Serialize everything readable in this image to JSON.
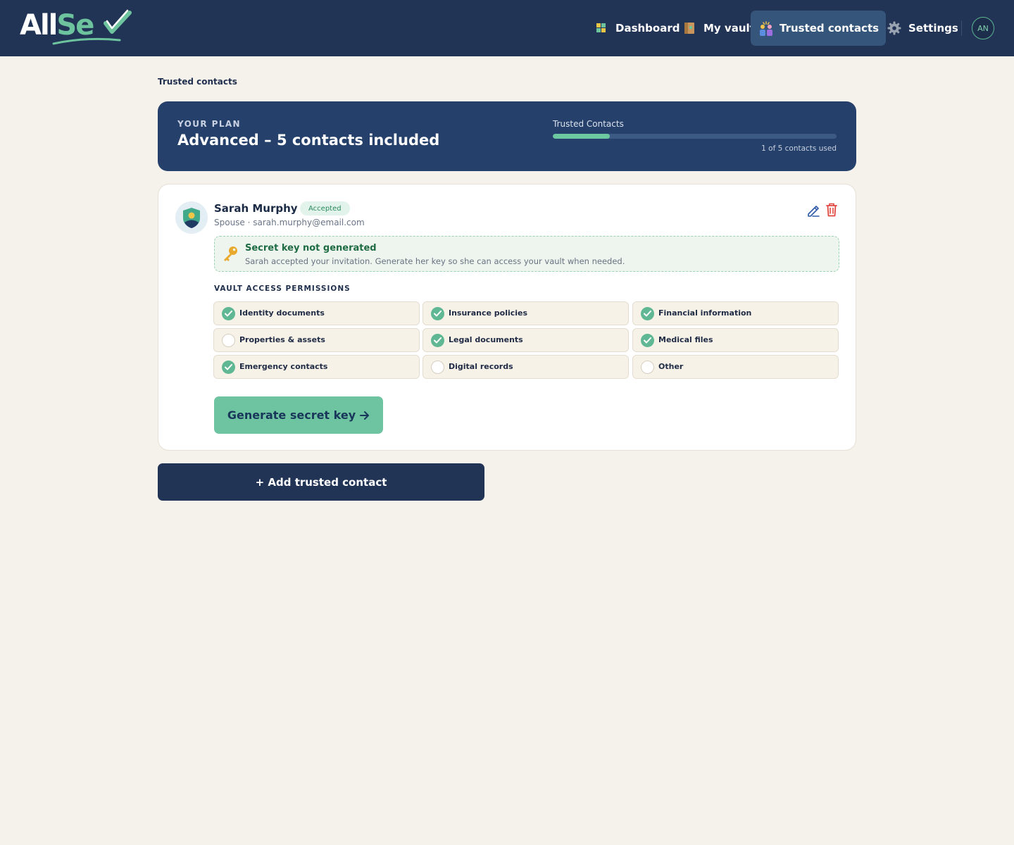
{
  "app": {
    "logo_text_a": "All",
    "logo_text_b": "Se"
  },
  "nav": {
    "items": [
      {
        "label": "Dashboard",
        "icon": "dashboard-icon"
      },
      {
        "label": "My vault",
        "icon": "vault-icon"
      },
      {
        "label": "Trusted contacts",
        "icon": "trusted-contacts-icon",
        "active": true
      },
      {
        "label": "Settings",
        "icon": "gear-icon"
      }
    ],
    "avatar_initials": "AN"
  },
  "breadcrumb": "Trusted contacts",
  "plan": {
    "eyebrow": "YOUR PLAN",
    "title": "Advanced – 5 contacts included",
    "usage_label": "Trusted Contacts",
    "usage_caption": "1 of 5 contacts used",
    "used": 1,
    "total": 5
  },
  "contact": {
    "name": "Sarah Murphy",
    "status": "Accepted",
    "meta": "Spouse · sarah.murphy@email.com",
    "notice_title": "Secret key not generated",
    "notice_text": "Sarah accepted your invitation. Generate her key so she can access your vault when needed.",
    "permissions_heading": "VAULT ACCESS PERMISSIONS",
    "permissions": [
      {
        "label": "Identity documents",
        "checked": true
      },
      {
        "label": "Insurance policies",
        "checked": true
      },
      {
        "label": "Financial information",
        "checked": true
      },
      {
        "label": "Properties & assets",
        "checked": false
      },
      {
        "label": "Legal documents",
        "checked": true
      },
      {
        "label": "Medical files",
        "checked": true
      },
      {
        "label": "Emergency contacts",
        "checked": true
      },
      {
        "label": "Digital records",
        "checked": false
      },
      {
        "label": "Other",
        "checked": false
      }
    ],
    "generate_label": "Generate secret key"
  },
  "add_contact_label": "+ Add trusted contact",
  "colors": {
    "topbar": "#223456",
    "accent_green": "#6ec3a0",
    "plan_card": "#25406a",
    "page_bg": "#f5f1eb",
    "delete_red": "#e0463f"
  }
}
